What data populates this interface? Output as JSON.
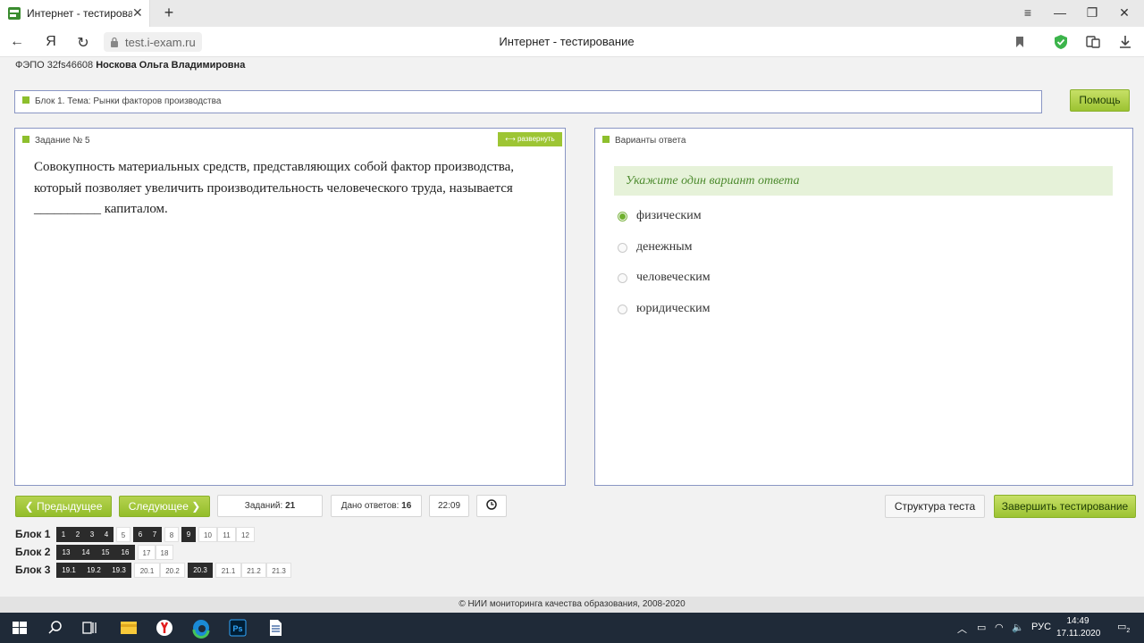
{
  "browser": {
    "tab_title": "Интернет - тестирование",
    "tab_close": "✕",
    "new_tab": "+",
    "win_menu": "≡",
    "win_minimize": "—",
    "win_restore": "❐",
    "win_close": "✕",
    "back": "←",
    "yandex": "Я",
    "reload": "↻",
    "url": "test.i-exam.ru",
    "page_title": "Интернет - тестирование"
  },
  "header": {
    "code": "ФЭПО 32fs46608",
    "user_name": "Носкова Ольга Владимировна"
  },
  "topic": {
    "label": "Блок 1. Тема: Рынки факторов производства"
  },
  "help_button": "Помощь",
  "task": {
    "title": "Задание № 5",
    "expand_label": "⟷ развернуть",
    "question": "Совокупность материальных средств, представляющих собой фактор производства, который позволяет увеличить производительность человеческого труда, называется __________ капиталом."
  },
  "answers": {
    "title": "Варианты ответа",
    "hint": "Укажите один вариант ответа",
    "options": [
      {
        "label": "физическим",
        "selected": true
      },
      {
        "label": "денежным",
        "selected": false
      },
      {
        "label": "человеческим",
        "selected": false
      },
      {
        "label": "юридическим",
        "selected": false
      }
    ]
  },
  "nav": {
    "prev": "Предыдущее",
    "next": "Следующее",
    "tasks_label": "Заданий:",
    "tasks_count": "21",
    "answered_label": "Дано ответов:",
    "answered_count": "16",
    "timer": "22:09",
    "structure": "Структура теста",
    "finish": "Завершить тестирование"
  },
  "blocks": [
    {
      "label": "Блок 1",
      "items": [
        {
          "n": "1",
          "done": true
        },
        {
          "n": "2",
          "done": true
        },
        {
          "n": "3",
          "done": true
        },
        {
          "n": "4",
          "done": true
        },
        {
          "n": "5",
          "done": false
        },
        {
          "n": "6",
          "done": true
        },
        {
          "n": "7",
          "done": true
        },
        {
          "n": "8",
          "done": false
        },
        {
          "n": "9",
          "done": true
        },
        {
          "n": "10",
          "done": false
        },
        {
          "n": "11",
          "done": false
        },
        {
          "n": "12",
          "done": false
        }
      ]
    },
    {
      "label": "Блок 2",
      "items": [
        {
          "n": "13",
          "done": true
        },
        {
          "n": "14",
          "done": true
        },
        {
          "n": "15",
          "done": true
        },
        {
          "n": "16",
          "done": true
        },
        {
          "n": "17",
          "done": false
        },
        {
          "n": "18",
          "done": false
        }
      ]
    },
    {
      "label": "Блок 3",
      "items": [
        {
          "n": "19.1",
          "done": true
        },
        {
          "n": "19.2",
          "done": true
        },
        {
          "n": "19.3",
          "done": true
        },
        {
          "n": "20.1",
          "done": false
        },
        {
          "n": "20.2",
          "done": false
        },
        {
          "n": "20.3",
          "done": true
        },
        {
          "n": "21.1",
          "done": false
        },
        {
          "n": "21.2",
          "done": false
        },
        {
          "n": "21.3",
          "done": false
        }
      ]
    }
  ],
  "footer": "© НИИ мониторинга качества образования, 2008-2020",
  "taskbar": {
    "lang": "РУС",
    "time": "14:49",
    "date": "17.11.2020",
    "notifications": "2"
  },
  "colors": {
    "accent_green": "#8dbf2d",
    "panel_border": "#8a96c4",
    "answered_dark": "#2b2b2b",
    "hint_bg": "#e6f2d9"
  }
}
